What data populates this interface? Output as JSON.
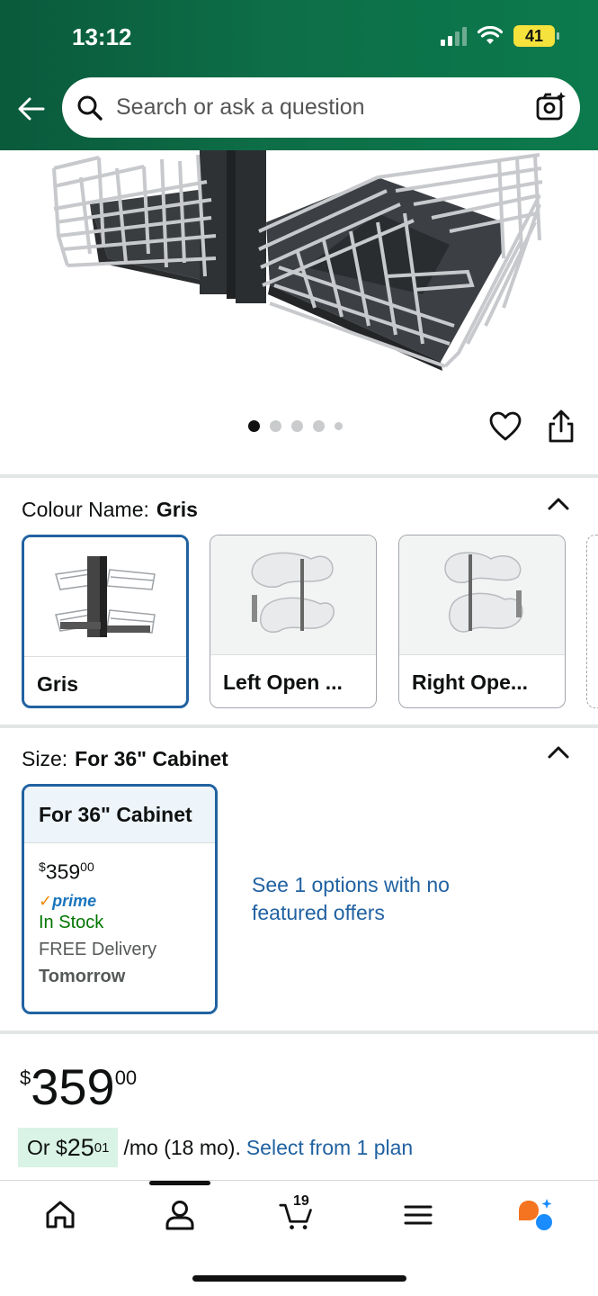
{
  "status_bar": {
    "time": "13:12",
    "battery": "41"
  },
  "search": {
    "placeholder": "Search or ask a question"
  },
  "gallery": {
    "image_count": 5,
    "active_index": 0
  },
  "colour": {
    "label": "Colour Name:",
    "selected": "Gris",
    "options": [
      {
        "label": "Gris"
      },
      {
        "label": "Left Open ..."
      },
      {
        "label": "Right Ope..."
      }
    ]
  },
  "size": {
    "label": "Size:",
    "selected": "For 36\" Cabinet",
    "card": {
      "title": "For 36\" Cabinet",
      "price_symbol": "$",
      "price_whole": "359",
      "price_fraction": "00",
      "prime": "prime",
      "stock": "In Stock",
      "delivery": "FREE Delivery",
      "delivery_day": "Tomorrow"
    },
    "see_options": "See 1 options with no featured offers"
  },
  "price": {
    "symbol": "$",
    "whole": "359",
    "fraction": "00"
  },
  "monthly": {
    "prefix": "Or $",
    "amount_whole": "25",
    "amount_fraction": "01",
    "suffix": "/mo (18 mo).",
    "link": "Select from 1 plan"
  },
  "bottom_nav": {
    "cart_count": "19"
  }
}
